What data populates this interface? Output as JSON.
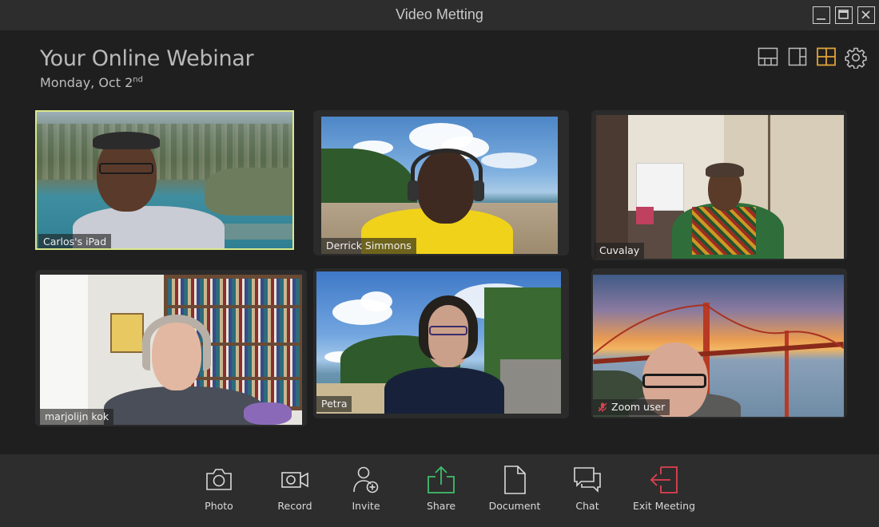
{
  "window": {
    "title": "Video Metting"
  },
  "header": {
    "title": "Your Online Webinar",
    "date": "Monday, Oct 2",
    "date_suffix": "nd"
  },
  "layout_controls": [
    {
      "icon": "layout-bottom-strip-icon"
    },
    {
      "icon": "layout-side-panel-icon"
    },
    {
      "icon": "layout-grid-icon",
      "active": true,
      "active_color": "#e0a33a"
    },
    {
      "icon": "gear-icon"
    }
  ],
  "participants": [
    {
      "name": "Carlos's iPad",
      "active_speaker": true,
      "muted": false
    },
    {
      "name": "Derrick Simmons",
      "active_speaker": false,
      "muted": false
    },
    {
      "name": "Cuvalay",
      "active_speaker": false,
      "muted": false
    },
    {
      "name": "marjolijn kok",
      "active_speaker": false,
      "muted": false
    },
    {
      "name": "Petra",
      "active_speaker": false,
      "muted": false
    },
    {
      "name": "Zoom user",
      "active_speaker": false,
      "muted": true
    }
  ],
  "toolbar": {
    "items": [
      {
        "label": "Photo",
        "icon": "camera-icon"
      },
      {
        "label": "Record",
        "icon": "video-camera-icon"
      },
      {
        "label": "Invite",
        "icon": "add-user-icon"
      },
      {
        "label": "Share",
        "icon": "share-upload-icon",
        "color": "#3fbf6a"
      },
      {
        "label": "Document",
        "icon": "document-icon"
      },
      {
        "label": "Chat",
        "icon": "chat-icon"
      },
      {
        "label": "Exit Meeting",
        "icon": "exit-icon",
        "color": "#e0414f"
      }
    ]
  },
  "colors": {
    "background": "#1f1f1f",
    "bars": "#2d2d2d",
    "active_speaker_border": "#d9e88a",
    "muted_mic": "#e0414f"
  }
}
